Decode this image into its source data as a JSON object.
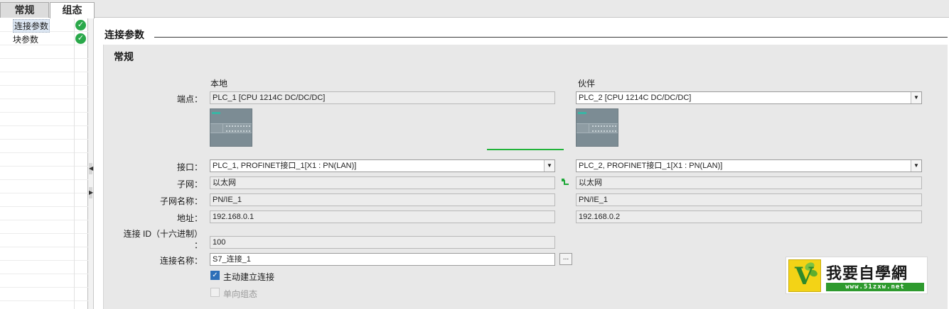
{
  "tabs": [
    {
      "label": "常规",
      "active": false
    },
    {
      "label": "组态",
      "active": true
    }
  ],
  "nav": {
    "items": [
      {
        "label": "连接参数",
        "selected": true,
        "status_icon": "check-circle-icon"
      },
      {
        "label": "块参数",
        "selected": false,
        "status_icon": "check-circle-icon"
      }
    ]
  },
  "section": {
    "title": "连接参数",
    "group_title": "常规",
    "local_header": "本地",
    "partner_header": "伙伴"
  },
  "labels": {
    "endpoint": "端点：",
    "interface": "接口：",
    "subnet": "子网：",
    "subnet_name": "子网名称：",
    "address": "地址：",
    "conn_id": "连接 ID（十六进制）",
    "conn_id_colon": "：",
    "conn_name": "连接名称："
  },
  "local": {
    "endpoint": "PLC_1 [CPU 1214C DC/DC/DC]",
    "interface": "PLC_1, PROFINET接口_1[X1 : PN(LAN)]",
    "subnet": "以太网",
    "subnet_name": "PN/IE_1",
    "address": "192.168.0.1",
    "conn_id": "100",
    "conn_name": "S7_连接_1"
  },
  "partner": {
    "endpoint": "PLC_2 [CPU 1214C DC/DC/DC]",
    "interface": "PLC_2, PROFINET接口_1[X1 : PN(LAN)]",
    "subnet": "以太网",
    "subnet_name": "PN/IE_1",
    "address": "192.168.0.2"
  },
  "buttons": {
    "browse": "..."
  },
  "options": {
    "active_connect": {
      "label": "主动建立连接",
      "checked": true,
      "enabled": true
    },
    "oneway": {
      "label": "单向组态",
      "checked": false,
      "enabled": false
    }
  },
  "watermark": {
    "brand": "我要自學網",
    "url": "www.51zxw.net"
  },
  "colors": {
    "accent_blue": "#2d6fb8",
    "status_green": "#2aa84a",
    "link_green": "#21b33a",
    "panel_gray": "#e8e8e8"
  }
}
